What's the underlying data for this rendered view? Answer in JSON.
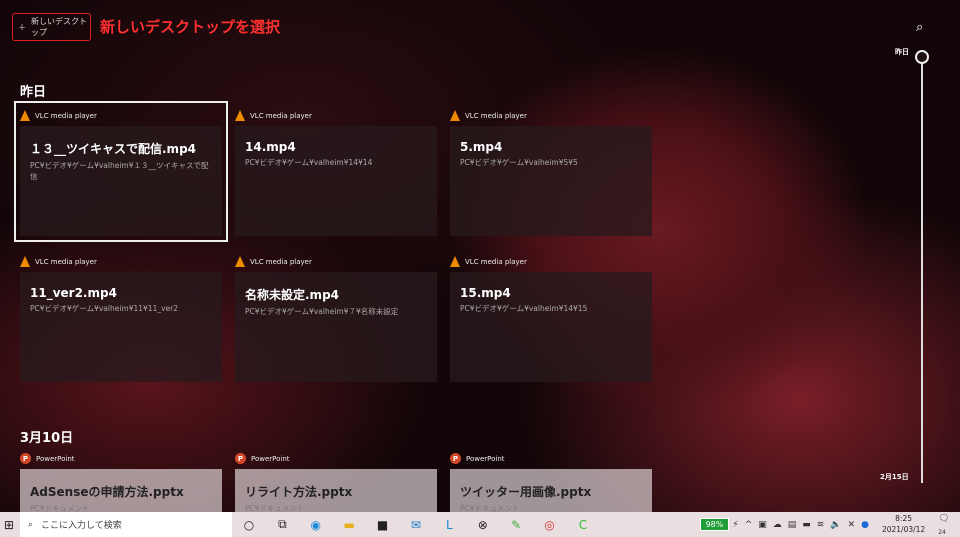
{
  "new_desktop": "新しいデスクトップ",
  "annotation": "新しいデスクトップを選択",
  "sections": [
    {
      "label": "昨日"
    },
    {
      "label": "3月10日"
    }
  ],
  "cards": [
    {
      "app": "VLC media player",
      "title": "１３__ツイキャスで配信.mp4",
      "path": "PC¥ビデオ¥ゲーム¥valheim¥１３__ツイキャスで配信"
    },
    {
      "app": "VLC media player",
      "title": "14.mp4",
      "path": "PC¥ビデオ¥ゲーム¥valheim¥14¥14"
    },
    {
      "app": "VLC media player",
      "title": "5.mp4",
      "path": "PC¥ビデオ¥ゲーム¥valheim¥5¥5"
    },
    {
      "app": "VLC media player",
      "title": "11_ver2.mp4",
      "path": "PC¥ビデオ¥ゲーム¥valheim¥11¥11_ver2"
    },
    {
      "app": "VLC media player",
      "title": "名称未設定.mp4",
      "path": "PC¥ビデオ¥ゲーム¥valheim¥７¥名称未設定"
    },
    {
      "app": "VLC media player",
      "title": "15.mp4",
      "path": "PC¥ビデオ¥ゲーム¥valheim¥14¥15"
    },
    {
      "app": "PowerPoint",
      "title": "AdSenseの申請方法.pptx",
      "path": "PC¥ドキュメント"
    },
    {
      "app": "PowerPoint",
      "title": "リライト方法.pptx",
      "path": "PC¥ドキュメント"
    },
    {
      "app": "PowerPoint",
      "title": "ツイッター用画像.pptx",
      "path": "PC¥ドキュメント"
    }
  ],
  "timeline": {
    "top": "昨日",
    "bottom": "2月15日"
  },
  "taskbar": {
    "search_placeholder": "ここに入力して検索",
    "battery": "98%",
    "time": "8:25",
    "date": "2021/03/12",
    "notifications": "24"
  }
}
